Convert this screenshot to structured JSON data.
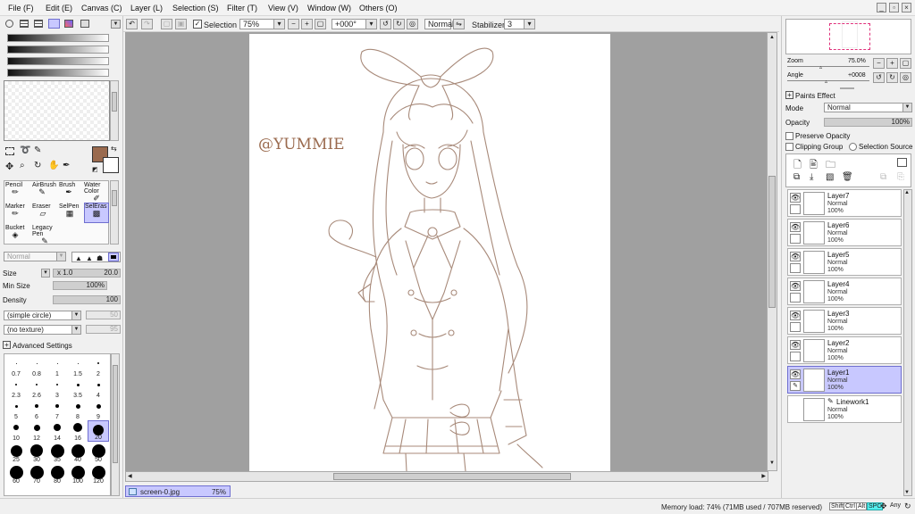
{
  "menu": [
    {
      "label": "File (F)"
    },
    {
      "label": "Edit (E)"
    },
    {
      "label": "Canvas (C)"
    },
    {
      "label": "Layer (L)"
    },
    {
      "label": "Selection (S)"
    },
    {
      "label": "Filter (T)"
    },
    {
      "label": "View (V)"
    },
    {
      "label": "Window (W)"
    },
    {
      "label": "Others (O)"
    }
  ],
  "toolbar": {
    "selection_label": "Selection",
    "zoom": "75%",
    "angle": "+000°",
    "mode": "Normal",
    "stabilizer_label": "Stabilizer",
    "stabilizer_value": "3"
  },
  "colors": {
    "primary": "#9a6a4e",
    "secondary": "#ffffff",
    "selection": "#c8c8ff",
    "canvas_bg": "#a0a0a0",
    "lineart": "#a88a7a"
  },
  "tools": [
    {
      "label": "Pencil",
      "icon": "pencil-icon"
    },
    {
      "label": "AirBrush",
      "icon": "airbrush-icon"
    },
    {
      "label": "Brush",
      "icon": "brush-icon"
    },
    {
      "label": "Water Color",
      "icon": "watercolor-icon"
    },
    {
      "label": "Marker",
      "icon": "marker-icon"
    },
    {
      "label": "Eraser",
      "icon": "eraser-icon"
    },
    {
      "label": "SelPen",
      "icon": "selpen-icon"
    },
    {
      "label": "SelEras",
      "icon": "seleras-icon"
    },
    {
      "label": "Bucket",
      "icon": "bucket-icon"
    },
    {
      "label": "Legacy Pen",
      "icon": "legacy-pen-icon"
    }
  ],
  "brush": {
    "blend_mode": "Normal",
    "size_label": "Size",
    "size_mult": "x 1.0",
    "size_value": "20.0",
    "minsize_label": "Min Size",
    "minsize_value": "100%",
    "density_label": "Density",
    "density_value": "100",
    "shape": "(simple circle)",
    "shape_value": "50",
    "texture": "(no texture)",
    "texture_value": "95",
    "advanced_label": "Advanced Settings"
  },
  "brush_sizes": [
    "0.7",
    "0.8",
    "1",
    "1.5",
    "2",
    "2.3",
    "2.6",
    "3",
    "3.5",
    "4",
    "5",
    "6",
    "7",
    "8",
    "9",
    "10",
    "12",
    "14",
    "16",
    "20",
    "25",
    "30",
    "35",
    "40",
    "50",
    "60",
    "70",
    "80",
    "100",
    "120"
  ],
  "selected_brush_size": "20",
  "canvas": {
    "watermark": "@YUMMIE"
  },
  "navigator": {
    "zoom_label": "Zoom",
    "zoom_value": "75.0%",
    "angle_label": "Angle",
    "angle_value": "+0008"
  },
  "layer_panel": {
    "paints_effect": "Paints Effect",
    "mode_label": "Mode",
    "mode_value": "Normal",
    "opacity_label": "Opacity",
    "opacity_value": "100%",
    "preserve_opacity": "Preserve Opacity",
    "clipping_group": "Clipping Group",
    "selection_source": "Selection Source"
  },
  "layers": [
    {
      "name": "Layer7",
      "mode": "Normal",
      "opacity": "100%"
    },
    {
      "name": "Layer6",
      "mode": "Normal",
      "opacity": "100%"
    },
    {
      "name": "Layer5",
      "mode": "Normal",
      "opacity": "100%"
    },
    {
      "name": "Layer4",
      "mode": "Normal",
      "opacity": "100%"
    },
    {
      "name": "Layer3",
      "mode": "Normal",
      "opacity": "100%"
    },
    {
      "name": "Layer2",
      "mode": "Normal",
      "opacity": "100%"
    },
    {
      "name": "Layer1",
      "mode": "Normal",
      "opacity": "100%"
    },
    {
      "name": "Linework1",
      "mode": "Normal",
      "opacity": "100%"
    }
  ],
  "selected_layer": "Layer1",
  "tab": {
    "filename": "screen-0.jpg",
    "zoom": "75%"
  },
  "status": {
    "memory": "Memory load: 74% (71MB used / 707MB reserved)",
    "keys": [
      "Shift",
      "Ctrl",
      "Alt",
      "SPC"
    ],
    "any": "Any"
  }
}
